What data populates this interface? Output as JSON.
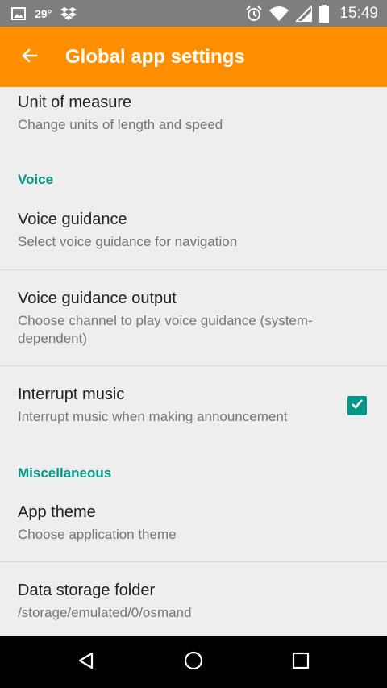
{
  "status_bar": {
    "temperature": "29°",
    "time": "15:49",
    "icons": [
      "image-icon",
      "dropbox-icon",
      "alarm-icon",
      "wifi-icon",
      "signal-icon",
      "battery-icon"
    ]
  },
  "app_bar": {
    "title": "Global app settings",
    "back_icon": "arrow-back-icon",
    "color": "#ff8f00"
  },
  "settings": {
    "unit_of_measure": {
      "title": "Unit of measure",
      "summary": "Change units of length and speed"
    },
    "voice_category": "Voice",
    "voice_guidance": {
      "title": "Voice guidance",
      "summary": "Select voice guidance for navigation"
    },
    "voice_guidance_output": {
      "title": "Voice guidance output",
      "summary": "Choose channel to play voice guidance (system-dependent)"
    },
    "interrupt_music": {
      "title": "Interrupt music",
      "summary": "Interrupt music when making announcement",
      "checked": true
    },
    "misc_category": "Miscellaneous",
    "app_theme": {
      "title": "App theme",
      "summary": "Choose application theme"
    },
    "data_storage_folder": {
      "title": "Data storage folder",
      "summary": "/storage/emulated/0/osmand"
    }
  },
  "nav_bar": {
    "icons": [
      "back-triangle-icon",
      "home-circle-icon",
      "recents-square-icon"
    ]
  },
  "colors": {
    "accent": "#009688",
    "app_bar": "#ff8f00",
    "status_bar": "#7e7e7e",
    "background": "#eeeeee"
  }
}
